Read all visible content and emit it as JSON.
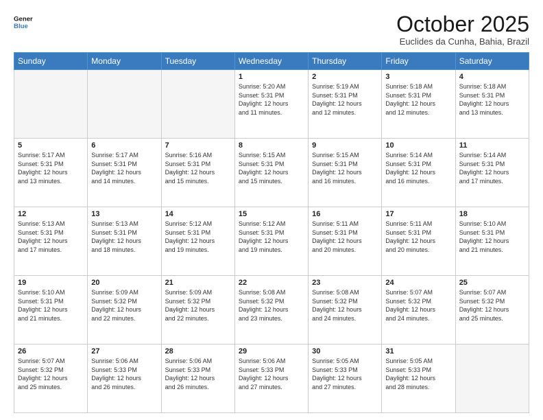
{
  "header": {
    "logo_line1": "General",
    "logo_line2": "Blue",
    "month": "October 2025",
    "location": "Euclides da Cunha, Bahia, Brazil"
  },
  "weekdays": [
    "Sunday",
    "Monday",
    "Tuesday",
    "Wednesday",
    "Thursday",
    "Friday",
    "Saturday"
  ],
  "weeks": [
    [
      {
        "day": "",
        "info": ""
      },
      {
        "day": "",
        "info": ""
      },
      {
        "day": "",
        "info": ""
      },
      {
        "day": "1",
        "info": "Sunrise: 5:20 AM\nSunset: 5:31 PM\nDaylight: 12 hours\nand 11 minutes."
      },
      {
        "day": "2",
        "info": "Sunrise: 5:19 AM\nSunset: 5:31 PM\nDaylight: 12 hours\nand 12 minutes."
      },
      {
        "day": "3",
        "info": "Sunrise: 5:18 AM\nSunset: 5:31 PM\nDaylight: 12 hours\nand 12 minutes."
      },
      {
        "day": "4",
        "info": "Sunrise: 5:18 AM\nSunset: 5:31 PM\nDaylight: 12 hours\nand 13 minutes."
      }
    ],
    [
      {
        "day": "5",
        "info": "Sunrise: 5:17 AM\nSunset: 5:31 PM\nDaylight: 12 hours\nand 13 minutes."
      },
      {
        "day": "6",
        "info": "Sunrise: 5:17 AM\nSunset: 5:31 PM\nDaylight: 12 hours\nand 14 minutes."
      },
      {
        "day": "7",
        "info": "Sunrise: 5:16 AM\nSunset: 5:31 PM\nDaylight: 12 hours\nand 15 minutes."
      },
      {
        "day": "8",
        "info": "Sunrise: 5:15 AM\nSunset: 5:31 PM\nDaylight: 12 hours\nand 15 minutes."
      },
      {
        "day": "9",
        "info": "Sunrise: 5:15 AM\nSunset: 5:31 PM\nDaylight: 12 hours\nand 16 minutes."
      },
      {
        "day": "10",
        "info": "Sunrise: 5:14 AM\nSunset: 5:31 PM\nDaylight: 12 hours\nand 16 minutes."
      },
      {
        "day": "11",
        "info": "Sunrise: 5:14 AM\nSunset: 5:31 PM\nDaylight: 12 hours\nand 17 minutes."
      }
    ],
    [
      {
        "day": "12",
        "info": "Sunrise: 5:13 AM\nSunset: 5:31 PM\nDaylight: 12 hours\nand 17 minutes."
      },
      {
        "day": "13",
        "info": "Sunrise: 5:13 AM\nSunset: 5:31 PM\nDaylight: 12 hours\nand 18 minutes."
      },
      {
        "day": "14",
        "info": "Sunrise: 5:12 AM\nSunset: 5:31 PM\nDaylight: 12 hours\nand 19 minutes."
      },
      {
        "day": "15",
        "info": "Sunrise: 5:12 AM\nSunset: 5:31 PM\nDaylight: 12 hours\nand 19 minutes."
      },
      {
        "day": "16",
        "info": "Sunrise: 5:11 AM\nSunset: 5:31 PM\nDaylight: 12 hours\nand 20 minutes."
      },
      {
        "day": "17",
        "info": "Sunrise: 5:11 AM\nSunset: 5:31 PM\nDaylight: 12 hours\nand 20 minutes."
      },
      {
        "day": "18",
        "info": "Sunrise: 5:10 AM\nSunset: 5:31 PM\nDaylight: 12 hours\nand 21 minutes."
      }
    ],
    [
      {
        "day": "19",
        "info": "Sunrise: 5:10 AM\nSunset: 5:31 PM\nDaylight: 12 hours\nand 21 minutes."
      },
      {
        "day": "20",
        "info": "Sunrise: 5:09 AM\nSunset: 5:32 PM\nDaylight: 12 hours\nand 22 minutes."
      },
      {
        "day": "21",
        "info": "Sunrise: 5:09 AM\nSunset: 5:32 PM\nDaylight: 12 hours\nand 22 minutes."
      },
      {
        "day": "22",
        "info": "Sunrise: 5:08 AM\nSunset: 5:32 PM\nDaylight: 12 hours\nand 23 minutes."
      },
      {
        "day": "23",
        "info": "Sunrise: 5:08 AM\nSunset: 5:32 PM\nDaylight: 12 hours\nand 24 minutes."
      },
      {
        "day": "24",
        "info": "Sunrise: 5:07 AM\nSunset: 5:32 PM\nDaylight: 12 hours\nand 24 minutes."
      },
      {
        "day": "25",
        "info": "Sunrise: 5:07 AM\nSunset: 5:32 PM\nDaylight: 12 hours\nand 25 minutes."
      }
    ],
    [
      {
        "day": "26",
        "info": "Sunrise: 5:07 AM\nSunset: 5:32 PM\nDaylight: 12 hours\nand 25 minutes."
      },
      {
        "day": "27",
        "info": "Sunrise: 5:06 AM\nSunset: 5:33 PM\nDaylight: 12 hours\nand 26 minutes."
      },
      {
        "day": "28",
        "info": "Sunrise: 5:06 AM\nSunset: 5:33 PM\nDaylight: 12 hours\nand 26 minutes."
      },
      {
        "day": "29",
        "info": "Sunrise: 5:06 AM\nSunset: 5:33 PM\nDaylight: 12 hours\nand 27 minutes."
      },
      {
        "day": "30",
        "info": "Sunrise: 5:05 AM\nSunset: 5:33 PM\nDaylight: 12 hours\nand 27 minutes."
      },
      {
        "day": "31",
        "info": "Sunrise: 5:05 AM\nSunset: 5:33 PM\nDaylight: 12 hours\nand 28 minutes."
      },
      {
        "day": "",
        "info": ""
      }
    ]
  ]
}
